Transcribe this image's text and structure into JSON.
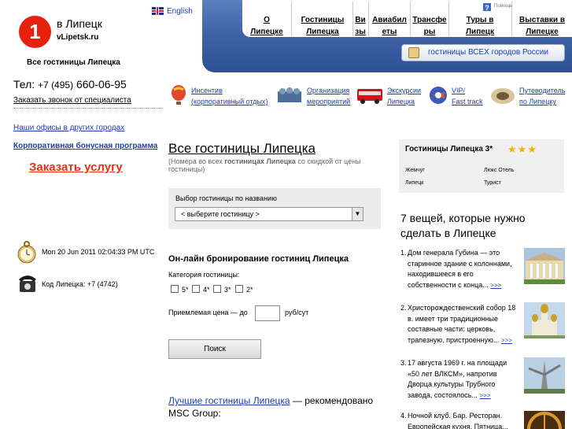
{
  "header": {
    "logo_char": "1",
    "brand": "в Липецк",
    "domain": "vLipetsk.ru",
    "all_hotels": "Все гостиницы Липецка",
    "lang": "English"
  },
  "nav": {
    "items": [
      {
        "label": "О Липецке"
      },
      {
        "label": "Гостиницы Липецка"
      },
      {
        "label": "Визы"
      },
      {
        "label": "Авиабилеты"
      },
      {
        "label": "Трансферы"
      },
      {
        "label": "Туры в Липецк"
      },
      {
        "label": "Выставки в Липецке"
      }
    ],
    "help_text": "Помощь",
    "all_cities": "гостиницы ВСЕХ городов России"
  },
  "contact": {
    "phone_label": "Тел:",
    "phone_code": "+7 (495)",
    "phone_number": "660-06-95",
    "callback": "Заказать звонок от специалиста",
    "offices": "Наши офисы в других городах",
    "bonus": "Корпоративная бонусная программа",
    "order": "Заказать услугу"
  },
  "features": [
    {
      "line1": "Инсентив",
      "line2": "(корпоративный отдых)"
    },
    {
      "line1": "Организация",
      "line2": "мероприятий"
    },
    {
      "line1": "Экскурсии",
      "line2": "Липецка"
    },
    {
      "line1": "VIP/",
      "line2": "Fast track"
    },
    {
      "line1": "Путеводитель",
      "line2": "по Липецку"
    }
  ],
  "info": {
    "time": "Mon 20 Jun 2011 02:04:33 PM UTC",
    "code": "Код Липецка: +7 (4742)"
  },
  "main": {
    "title": "Все гостиницы Липецка",
    "subtitle_pre": "(Номера во всех ",
    "subtitle_bold": "гостиницах Липецка",
    "subtitle_post": " со скидкой от цены гостиницы)",
    "select_label": "Выбор гостиницы по названию",
    "select_value": "< выберите гостиницу >",
    "online_title": "Он-лайн бронирование гостиниц Липецка",
    "category_label": "Категория гостиницы:",
    "categories": [
      "5*",
      "4*",
      "3*",
      "2*"
    ],
    "price_label": "Приемлемая цена — до",
    "price_value": "",
    "price_unit": "руб/сут",
    "search_button": "Поиск",
    "best_link": "Лучшие гостиницы Липецка",
    "best_text": " — рекомендовано MSC Group:"
  },
  "sidebar": {
    "hotels_title": "Гостиницы Липецка 3*",
    "star_rating": 3,
    "hotels": [
      "Жемчуг",
      "Люкс Отель",
      "Липецк",
      "Турист"
    ],
    "things_title": "7 вещей, которые нужно сделать в Липецке",
    "things": [
      {
        "num": "1.",
        "text": "Дом генерала Губина — это старинное здание с колоннами, находившееся в его собственности с конца...",
        "more": ">>>"
      },
      {
        "num": "2.",
        "text": "Христорождественский собор 18 в. имеет три традиционные составные части: церковь, трапезную, пристроенную...",
        "more": ">>>"
      },
      {
        "num": "3.",
        "text": "17 августа 1969 г. на площади «50 лет ВЛКСМ», напротив Дворца культуры Трубного завода, состоялось...",
        "more": ">>>"
      },
      {
        "num": "4.",
        "text": "Ночной клуб. Бар. Ресторан. Европейская кухня. Пятница...",
        "more": ""
      }
    ]
  }
}
